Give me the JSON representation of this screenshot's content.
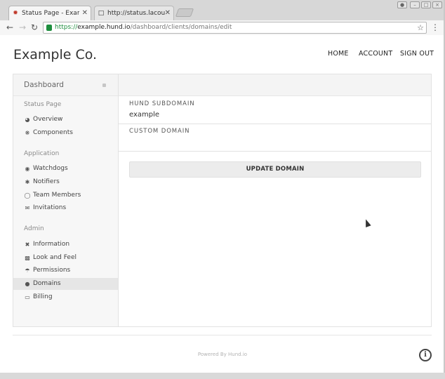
{
  "browser": {
    "tabs": [
      {
        "title": "Status Page - Exam",
        "active": true,
        "favicon": "hund-logo-icon"
      },
      {
        "title": "http://status.lacour.",
        "active": false,
        "favicon": "page-icon"
      }
    ],
    "address_bar": {
      "scheme": "https://",
      "host": "example.hund.io",
      "path": "/dashboard/clients/domains/edit"
    }
  },
  "header": {
    "brand": "Example Co.",
    "nav": [
      "HOME",
      "ACCOUNT",
      "SIGN OUT"
    ]
  },
  "sidebar": {
    "title": "Dashboard",
    "sections": [
      {
        "title": "Status Page",
        "items": [
          {
            "label": "Overview",
            "icon": "gauge-icon"
          },
          {
            "label": "Components",
            "icon": "components-icon"
          }
        ]
      },
      {
        "title": "Application",
        "items": [
          {
            "label": "Watchdogs",
            "icon": "eye-icon"
          },
          {
            "label": "Notifiers",
            "icon": "broadcast-icon"
          },
          {
            "label": "Team Members",
            "icon": "globe-icon"
          },
          {
            "label": "Invitations",
            "icon": "envelope-icon"
          }
        ]
      },
      {
        "title": "Admin",
        "items": [
          {
            "label": "Information",
            "icon": "tools-icon"
          },
          {
            "label": "Look and Feel",
            "icon": "bucket-icon"
          },
          {
            "label": "Permissions",
            "icon": "shield-icon"
          },
          {
            "label": "Domains",
            "icon": "globe-icon",
            "active": true
          },
          {
            "label": "Billing",
            "icon": "credit-card-icon"
          }
        ]
      }
    ]
  },
  "form": {
    "subdomain_label": "HUND SUBDOMAIN",
    "subdomain_value": "example",
    "custom_domain_label": "CUSTOM DOMAIN",
    "custom_domain_value": "",
    "submit_label": "UPDATE DOMAIN"
  },
  "footer": {
    "powered_by": "Powered By Hund.io",
    "info_glyph": "i"
  },
  "colors": {
    "sidebar_bg": "#f7f7f7",
    "active_item_bg": "#e6e6e6",
    "secure_green": "#1e8e3e",
    "button_bg": "#ececec"
  }
}
